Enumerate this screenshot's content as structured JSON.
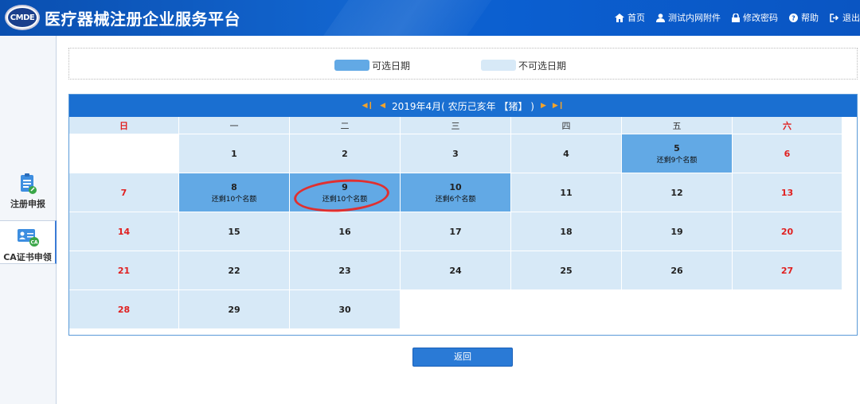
{
  "header": {
    "logo_text": "CMDE",
    "title": "医疗器械注册企业服务平台",
    "nav": [
      {
        "label": "首页",
        "icon": "home-icon"
      },
      {
        "label": "测试内网附件",
        "icon": "user-icon"
      },
      {
        "label": "修改密码",
        "icon": "lock-icon"
      },
      {
        "label": "帮助",
        "icon": "help-icon"
      },
      {
        "label": "退出",
        "icon": "logout-icon"
      }
    ]
  },
  "sidebar": {
    "items": [
      {
        "label": "注册申报",
        "icon": "clipboard-icon"
      },
      {
        "label": "CA证书申领",
        "icon": "certificate-icon"
      }
    ]
  },
  "legend": {
    "available": "可选日期",
    "unavailable": "不可选日期",
    "available_color": "#62a9e5",
    "unavailable_color": "#d7e9f7"
  },
  "calendar": {
    "title": "2019年4月( 农历己亥年 【猪】 )",
    "weekdays": [
      "日",
      "一",
      "二",
      "三",
      "四",
      "五",
      "六"
    ],
    "cells": [
      {
        "day": "",
        "note": ""
      },
      {
        "day": "1",
        "note": ""
      },
      {
        "day": "2",
        "note": ""
      },
      {
        "day": "3",
        "note": ""
      },
      {
        "day": "4",
        "note": ""
      },
      {
        "day": "5",
        "note": "还剩9个名额"
      },
      {
        "day": "6",
        "note": ""
      },
      {
        "day": "7",
        "note": ""
      },
      {
        "day": "8",
        "note": "还剩10个名额"
      },
      {
        "day": "9",
        "note": "还剩10个名额"
      },
      {
        "day": "10",
        "note": "还剩6个名额"
      },
      {
        "day": "11",
        "note": ""
      },
      {
        "day": "12",
        "note": ""
      },
      {
        "day": "13",
        "note": ""
      },
      {
        "day": "14",
        "note": ""
      },
      {
        "day": "15",
        "note": ""
      },
      {
        "day": "16",
        "note": ""
      },
      {
        "day": "17",
        "note": ""
      },
      {
        "day": "18",
        "note": ""
      },
      {
        "day": "19",
        "note": ""
      },
      {
        "day": "20",
        "note": ""
      },
      {
        "day": "21",
        "note": ""
      },
      {
        "day": "22",
        "note": ""
      },
      {
        "day": "23",
        "note": ""
      },
      {
        "day": "24",
        "note": ""
      },
      {
        "day": "25",
        "note": ""
      },
      {
        "day": "26",
        "note": ""
      },
      {
        "day": "27",
        "note": ""
      },
      {
        "day": "28",
        "note": ""
      },
      {
        "day": "29",
        "note": ""
      },
      {
        "day": "30",
        "note": ""
      },
      {
        "day": "",
        "note": ""
      },
      {
        "day": "",
        "note": ""
      },
      {
        "day": "",
        "note": ""
      },
      {
        "day": "",
        "note": ""
      }
    ]
  },
  "back_button": "返回"
}
